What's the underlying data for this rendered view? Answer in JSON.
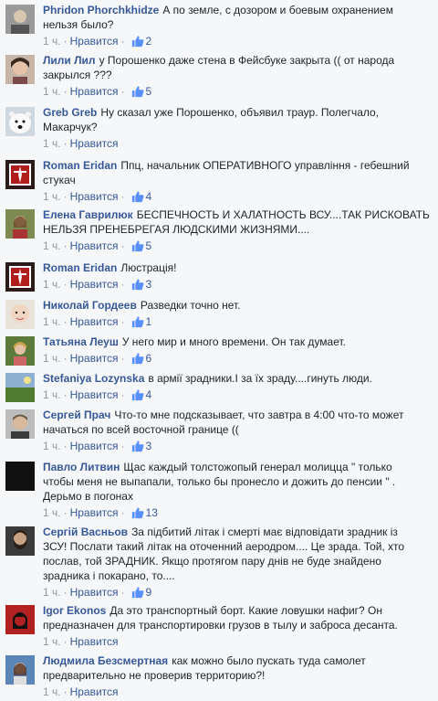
{
  "like_label": "Нравится",
  "comments": [
    {
      "author": "Phridon Phorchkhidze",
      "text": "А по земле, с дозором и боевым охранением\nнельзя было?",
      "time": "1 ч.",
      "likes": "2",
      "avatar": "gray-face"
    },
    {
      "author": "Лили Лил",
      "text": "у Порошенко даже стена в Фейсбуке закрыта (( от народа\nзакрылся ???",
      "time": "1 ч.",
      "likes": "5",
      "avatar": "woman-face"
    },
    {
      "author": "Greb Greb",
      "text": "Ну сказал уже Порошенко, объявил траур. Полегчало,\nМакарчук?",
      "time": "1 ч.",
      "likes": "",
      "avatar": "polar-bear"
    },
    {
      "author": "Roman Eridan",
      "text": "Ппц, начальник ОПЕРАТИВНОГО управлiння - гебешний\nстукач",
      "time": "1 ч.",
      "likes": "4",
      "avatar": "red-emblem"
    },
    {
      "author": "Елена Гаврилюк",
      "text": "БЕСПЕЧНОСТЬ И ХАЛАТНОСТЬ ВСУ....ТАК РИСКОВАТЬ\nНЕЛЬЗЯ ПРЕНЕБРЕГАЯ ЛЮДСКИМИ ЖИЗНЯМИ....",
      "time": "1 ч.",
      "likes": "5",
      "avatar": "woman-outdoor"
    },
    {
      "author": "Roman Eridan",
      "text": "Люстрацiя!",
      "time": "1 ч.",
      "likes": "3",
      "avatar": "red-emblem"
    },
    {
      "author": "Николай Гордеев",
      "text": "Разведки точно нет.",
      "time": "1 ч.",
      "likes": "1",
      "avatar": "child-face"
    },
    {
      "author": "Татьяна Леуш",
      "text": "У него мир и много времени. Он так думает.",
      "time": "1 ч.",
      "likes": "6",
      "avatar": "woman-trees"
    },
    {
      "author": "Stefaniya Lozynska",
      "text": "в армiї зрадники.I за їх зраду....гинуть люди.",
      "time": "1 ч.",
      "likes": "4",
      "avatar": "green-landscape"
    },
    {
      "author": "Сергей Прач",
      "text": "Что-то мне подсказывает, что завтра в 4:00 что-то может\nначаться по всей восточной границе ((",
      "time": "1 ч.",
      "likes": "3",
      "avatar": "man-face"
    },
    {
      "author": "Павло Литвин",
      "text": "Щас каждый толстожопый генерал молицца \" только\nчтобы меня не выпапали, только бы пронесло и дожить до пенсии \" .\nДерьмо в погонах",
      "time": "1 ч.",
      "likes": "13",
      "avatar": "black"
    },
    {
      "author": "Сергiй Васньов",
      "text": "За пiдбитий лiтак i смертi має вiдповiдати зрадник iз\nЗСУ! Послати такий лiтак на оточенний аеродром.... Це зрада. Той, хто\nпослав, той ЗРАДНИК. Якщо протягом пару днiв не буде знайдено\nзрадника i покарано, то....",
      "time": "1 ч.",
      "likes": "9",
      "avatar": "bearded-man"
    },
    {
      "author": "Igor Ekonos",
      "text": "Да это транспортный борт. Какие ловушки нафиг? Он\nпредназначен для транспортировки грузов в тылу и заброса десанта.",
      "time": "1 ч.",
      "likes": "",
      "avatar": "che-portrait"
    },
    {
      "author": "Людмила Безсмертная",
      "text": "как можно было пускать туда самолет\nпредварительно не проверив территорию?!",
      "time": "1 ч.",
      "likes": "",
      "avatar": "woman-blue"
    }
  ]
}
